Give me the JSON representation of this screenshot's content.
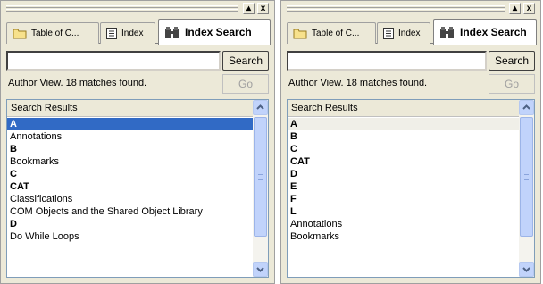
{
  "left": {
    "tabs": [
      {
        "label": "Table of C...",
        "icon": "folder-icon"
      },
      {
        "label": "Index",
        "icon": "index-icon"
      },
      {
        "label": "Index Search",
        "icon": "binoculars-icon"
      }
    ],
    "search": {
      "value": "",
      "button": "Search"
    },
    "status": "Author View.  18 matches found.",
    "go": "Go",
    "results_header": "Search Results",
    "results": [
      {
        "text": "A",
        "bold": true,
        "selected": true
      },
      {
        "text": "Annotations",
        "bold": false
      },
      {
        "text": "B",
        "bold": true
      },
      {
        "text": "Bookmarks",
        "bold": false
      },
      {
        "text": "C",
        "bold": true
      },
      {
        "text": "CAT",
        "bold": true
      },
      {
        "text": "Classifications",
        "bold": false
      },
      {
        "text": "COM Objects and the Shared Object Library",
        "bold": false
      },
      {
        "text": "D",
        "bold": true
      },
      {
        "text": "Do While Loops",
        "bold": false
      }
    ]
  },
  "right": {
    "tabs": [
      {
        "label": "Table of C...",
        "icon": "folder-icon"
      },
      {
        "label": "Index",
        "icon": "index-icon"
      },
      {
        "label": "Index Search",
        "icon": "binoculars-icon"
      }
    ],
    "search": {
      "value": "",
      "button": "Search"
    },
    "status": "Author View.  18 matches found.",
    "go": "Go",
    "results_header": "Search Results",
    "results": [
      {
        "text": "A",
        "bold": true,
        "hover": true
      },
      {
        "text": "B",
        "bold": true
      },
      {
        "text": "C",
        "bold": true
      },
      {
        "text": "CAT",
        "bold": true
      },
      {
        "text": "D",
        "bold": true
      },
      {
        "text": "E",
        "bold": true
      },
      {
        "text": "F",
        "bold": true
      },
      {
        "text": "L",
        "bold": true
      },
      {
        "text": "Annotations",
        "bold": false
      },
      {
        "text": "Bookmarks",
        "bold": false
      }
    ]
  },
  "window_controls": {
    "minimize": "▴",
    "close": "x"
  }
}
